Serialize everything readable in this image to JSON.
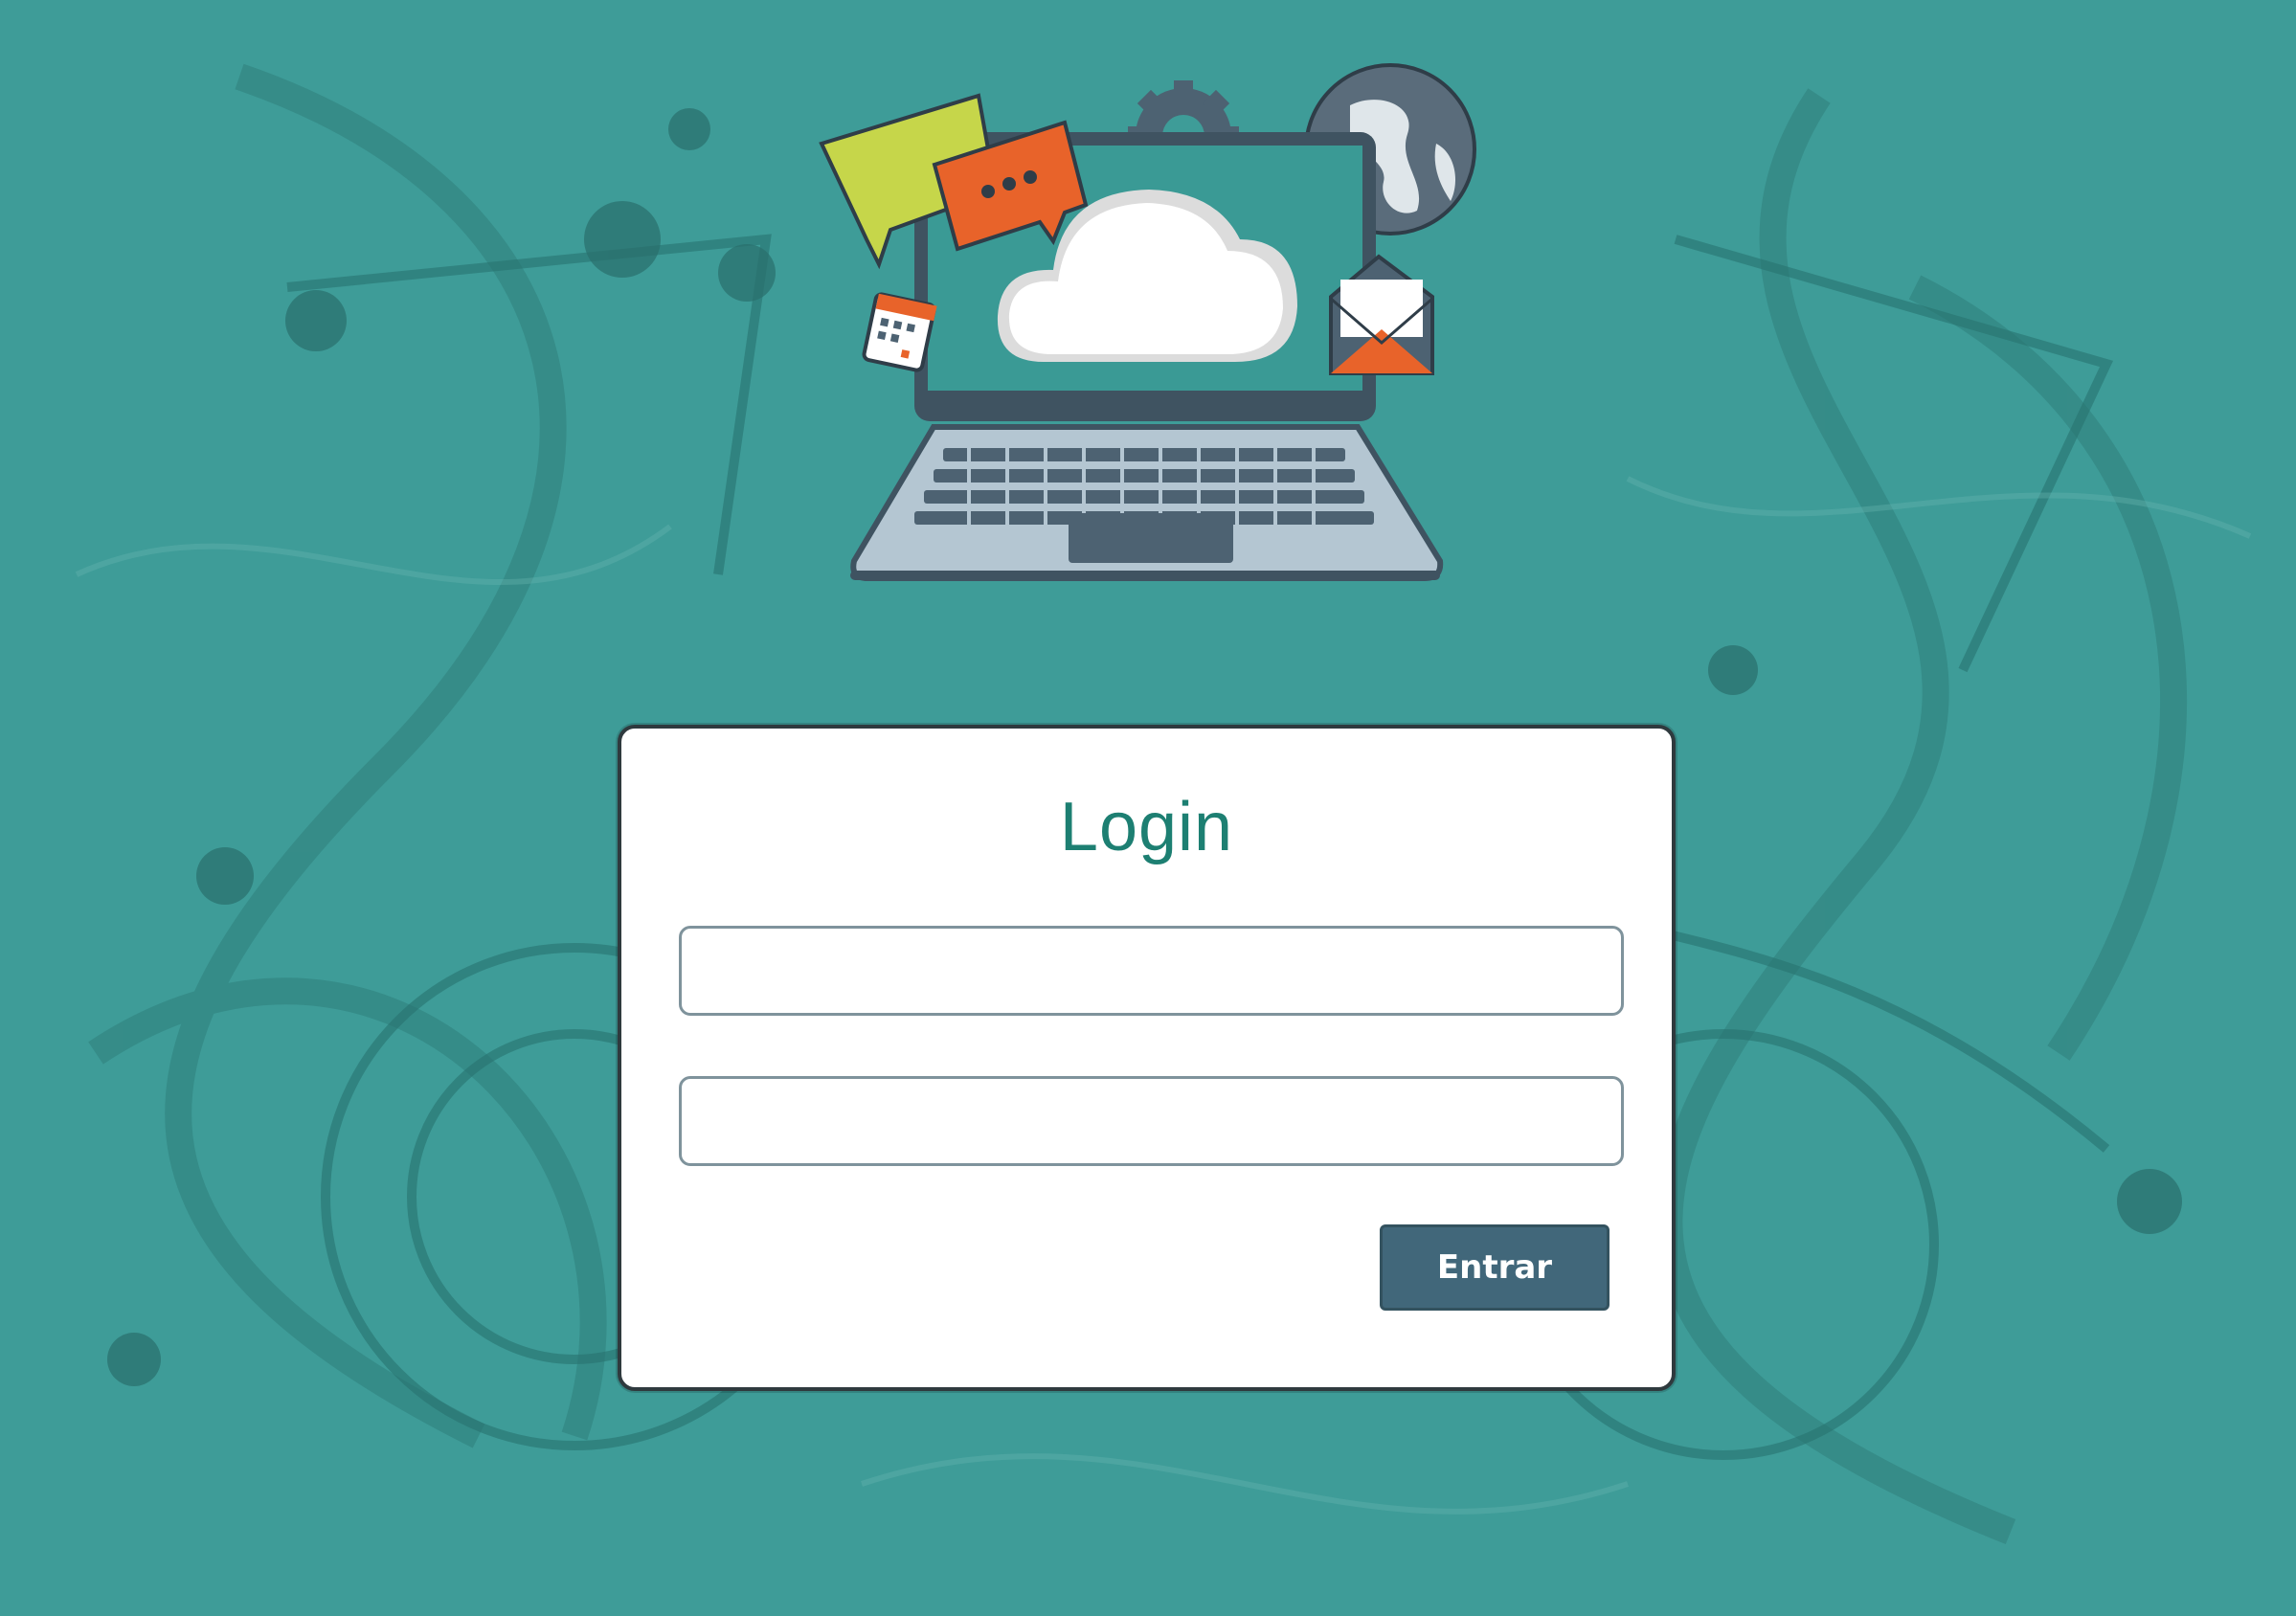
{
  "login": {
    "title": "Login",
    "username_value": "",
    "username_placeholder": "",
    "password_value": "",
    "password_placeholder": "",
    "submit_label": "Entrar"
  },
  "colors": {
    "background": "#3e9c98",
    "title": "#1d7f72",
    "button": "#41677a",
    "card": "#ffffff"
  },
  "icons": [
    "laptop-icon",
    "cloud-icon",
    "chat-bubble-icon",
    "calendar-icon",
    "gear-icon",
    "globe-icon",
    "envelope-icon"
  ]
}
